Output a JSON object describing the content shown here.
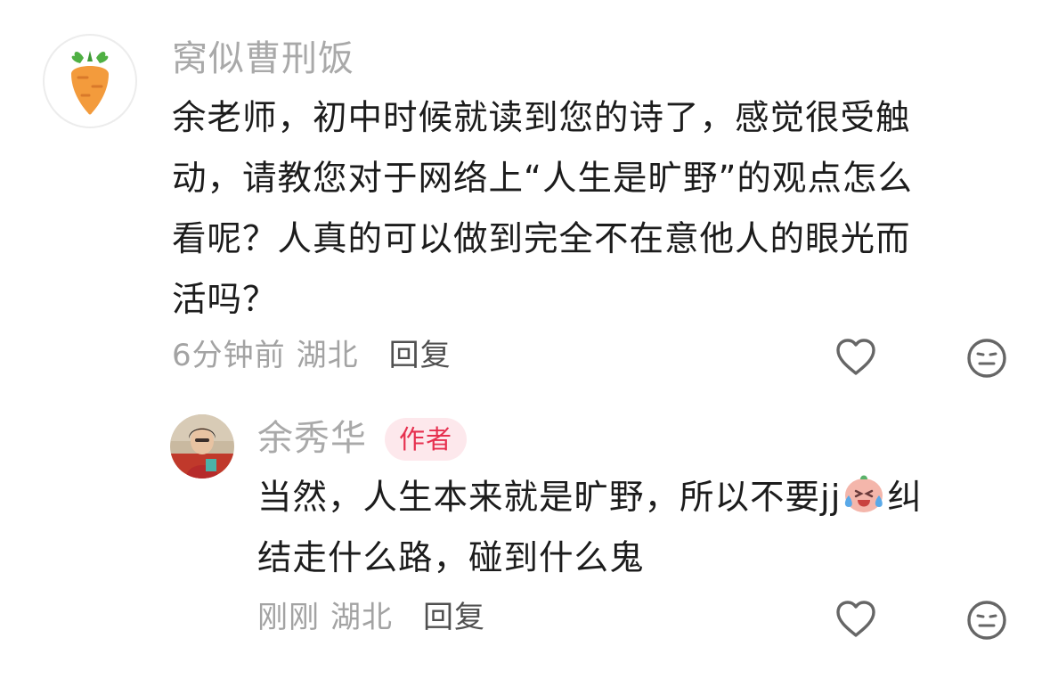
{
  "comment": {
    "username": "窝似曹刑饭",
    "avatar_icon": "carrot-icon",
    "text_lines": [
      "余老师，初中时候就读到您的诗了，感觉很受触",
      "动，请教您对于网络上“人生是旷野”的观点怎么",
      "看呢？人真的可以做到完全不在意他人的眼光而",
      "活吗？"
    ],
    "time": "6分钟前",
    "location": "湖北",
    "reply_label": "回复",
    "like_icon": "heart-outline-icon",
    "dislike_icon": "meh-face-icon"
  },
  "reply": {
    "username": "余秀华",
    "badge": "作者",
    "avatar_icon": "author-photo-avatar",
    "text_line1_before": "当然，人生本来就是旷野，所以不要jj",
    "emoji_icon": "crying-laughing-emoji-icon",
    "text_line1_after": "纠",
    "text_line2": "结走什么路，碰到什么鬼",
    "time": "刚刚",
    "location": "湖北",
    "reply_label": "回复",
    "like_icon": "heart-outline-icon",
    "dislike_icon": "meh-face-icon"
  },
  "colors": {
    "text": "#1c1c1c",
    "muted": "#a3a3a3",
    "badge_bg": "#fde8ec",
    "badge_text": "#e6304f",
    "carrot": "#f39b3c",
    "carrot_leaf": "#4fb043"
  }
}
